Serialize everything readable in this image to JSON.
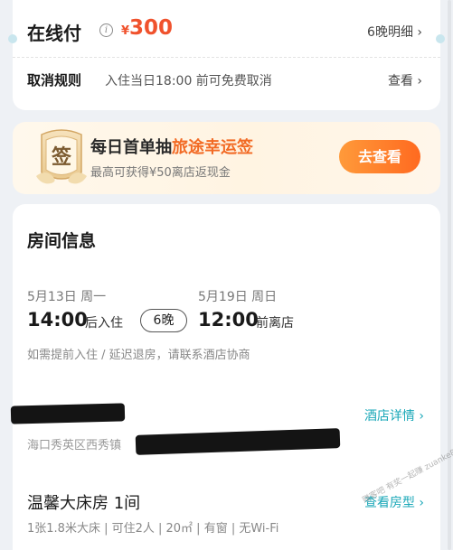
{
  "payment": {
    "title": "在线付",
    "info_icon": "info-icon",
    "currency": "¥",
    "amount": "300",
    "detail_link": "6晚明细 ›"
  },
  "cancel": {
    "title": "取消规则",
    "description": "入住当日18:00 前可免费取消",
    "view_link": "查看 ›"
  },
  "lottery": {
    "badge_char": "签",
    "title_prefix": "每日首单抽",
    "title_highlight": "旅途幸运签",
    "subtitle": "最高可获得¥50离店返现金",
    "button": "去查看"
  },
  "room": {
    "heading": "房间信息",
    "checkin_date": "5月13日 周一",
    "checkin_time": "14:00",
    "checkin_suffix": "后入住",
    "nights": "6晚",
    "checkout_date": "5月19日 周日",
    "checkout_time": "12:00",
    "checkout_suffix": "前离店",
    "note": "如需提前入住 / 延迟退房，请联系酒店协商",
    "hotel_detail_link": "酒店详情 ›",
    "address": "海口秀英区西秀镇",
    "room_name": "温馨大床房 1间",
    "room_type_link": "查看房型 ›",
    "specs": "1张1.8米大床 | 可住2人 | 20㎡ | 有窗 | 无Wi-Fi"
  },
  "watermark": "赚客吧 有奖一起赚 zuanke8",
  "colors": {
    "price": "#f0522d",
    "accent_link": "#1ba8b8",
    "button_orange": "#ff6a20",
    "highlight_orange": "#f26a24"
  }
}
